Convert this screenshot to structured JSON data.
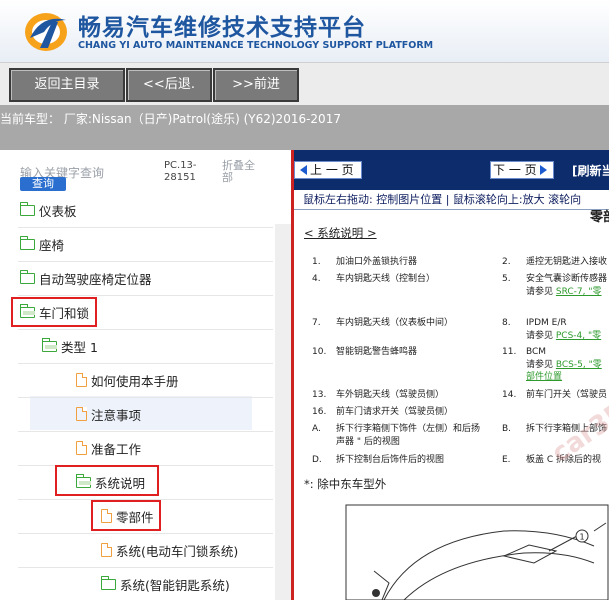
{
  "header": {
    "title_cn": "畅易汽车维修技术支持平台",
    "title_en": "CHANG YI AUTO MAINTENANCE TECHNOLOGY SUPPORT PLATFORM",
    "logo_icon": "cy-logo-icon"
  },
  "nav": {
    "home": "返回主目录",
    "back": "<<后退.",
    "forward": ">>前进"
  },
  "model_bar": {
    "text": "当前车型：  厂家:Nissan（日产)Patrol(途乐) (Y62)2016-2017"
  },
  "left": {
    "search_placeholder": "输入关键字查询",
    "search_button": "查询",
    "pc_code": "PC.13-28151",
    "collapse_all": "折叠全部",
    "tree": [
      {
        "label": "仪表板",
        "icon": "folder-icon"
      },
      {
        "label": "座椅",
        "icon": "folder-icon"
      },
      {
        "label": "自动驾驶座椅定位器",
        "icon": "folder-icon"
      },
      {
        "label": "车门和锁",
        "icon": "folder-open-icon"
      },
      {
        "label": "类型 1",
        "icon": "folder-open-icon"
      },
      {
        "label": "如何使用本手册",
        "icon": "document-icon"
      },
      {
        "label": "注意事项",
        "icon": "document-icon"
      },
      {
        "label": "准备工作",
        "icon": "document-icon"
      },
      {
        "label": "系统说明",
        "icon": "folder-open-icon"
      },
      {
        "label": "零部件",
        "icon": "document-icon"
      },
      {
        "label": "系统(电动车门锁系统)",
        "icon": "document-icon"
      },
      {
        "label": "系统(智能钥匙系统)",
        "icon": "folder-icon"
      }
    ]
  },
  "right": {
    "prev_button": "上 一 页",
    "next_button": "下 一 页",
    "refresh": "[刷新当",
    "hint": "鼠标左右拖动: 控制图片位置 | 鼠标滚轮向上:放大  滚轮向",
    "doc_title": "零部",
    "section_heading": "< 系统说明 >",
    "items": [
      {
        "num": "1.",
        "text": "加油口外盖锁执行器",
        "num2": "2.",
        "text2": "遥控无钥匙进入接收"
      },
      {
        "num": "4.",
        "text": "车内钥匙天线（控制台）",
        "num2": "5.",
        "text2": "安全气囊诊断传感器"
      },
      {
        "num": "",
        "text": "",
        "num2": "",
        "text2": "请参见 ",
        "link2": "SRC-7, \"零"
      },
      {
        "num": "7.",
        "text": "车内钥匙天线（仪表板中间）",
        "num2": "8.",
        "text2": "IPDM E/R"
      },
      {
        "num": "",
        "text": "",
        "num2": "",
        "text2": "请参见 ",
        "link2": "PCS-4, \"零"
      },
      {
        "num": "10.",
        "text": "智能钥匙警告蜂鸣器",
        "num2": "11.",
        "text2": "BCM"
      },
      {
        "num": "",
        "text": "",
        "num2": "",
        "text2": "请参见 ",
        "link2": "BCS-5, \"零"
      },
      {
        "num": "",
        "text": "",
        "num2": "",
        "text2": "",
        "link2": "部件位置"
      },
      {
        "num": "13.",
        "text": "车外钥匙天线（驾驶员侧）",
        "num2": "14.",
        "text2": "前车门开关（驾驶员"
      },
      {
        "num": "16.",
        "text": "前车门请求开关（驾驶员侧）",
        "num2": "",
        "text2": ""
      },
      {
        "num": "A.",
        "text": "拆下行李箱侧下饰件（左侧）和后扬",
        "num2": "B.",
        "text2": "拆下行李箱侧上部饰"
      },
      {
        "num": "",
        "text": "声器 \" 后的视图",
        "num2": "",
        "text2": ""
      },
      {
        "num": "D.",
        "text": "拆下控制台后饰件后的视图",
        "num2": "E.",
        "text2": "板盖 C 拆除后的视"
      }
    ],
    "note": "*:  除中东车型外",
    "watermark": "car358"
  }
}
